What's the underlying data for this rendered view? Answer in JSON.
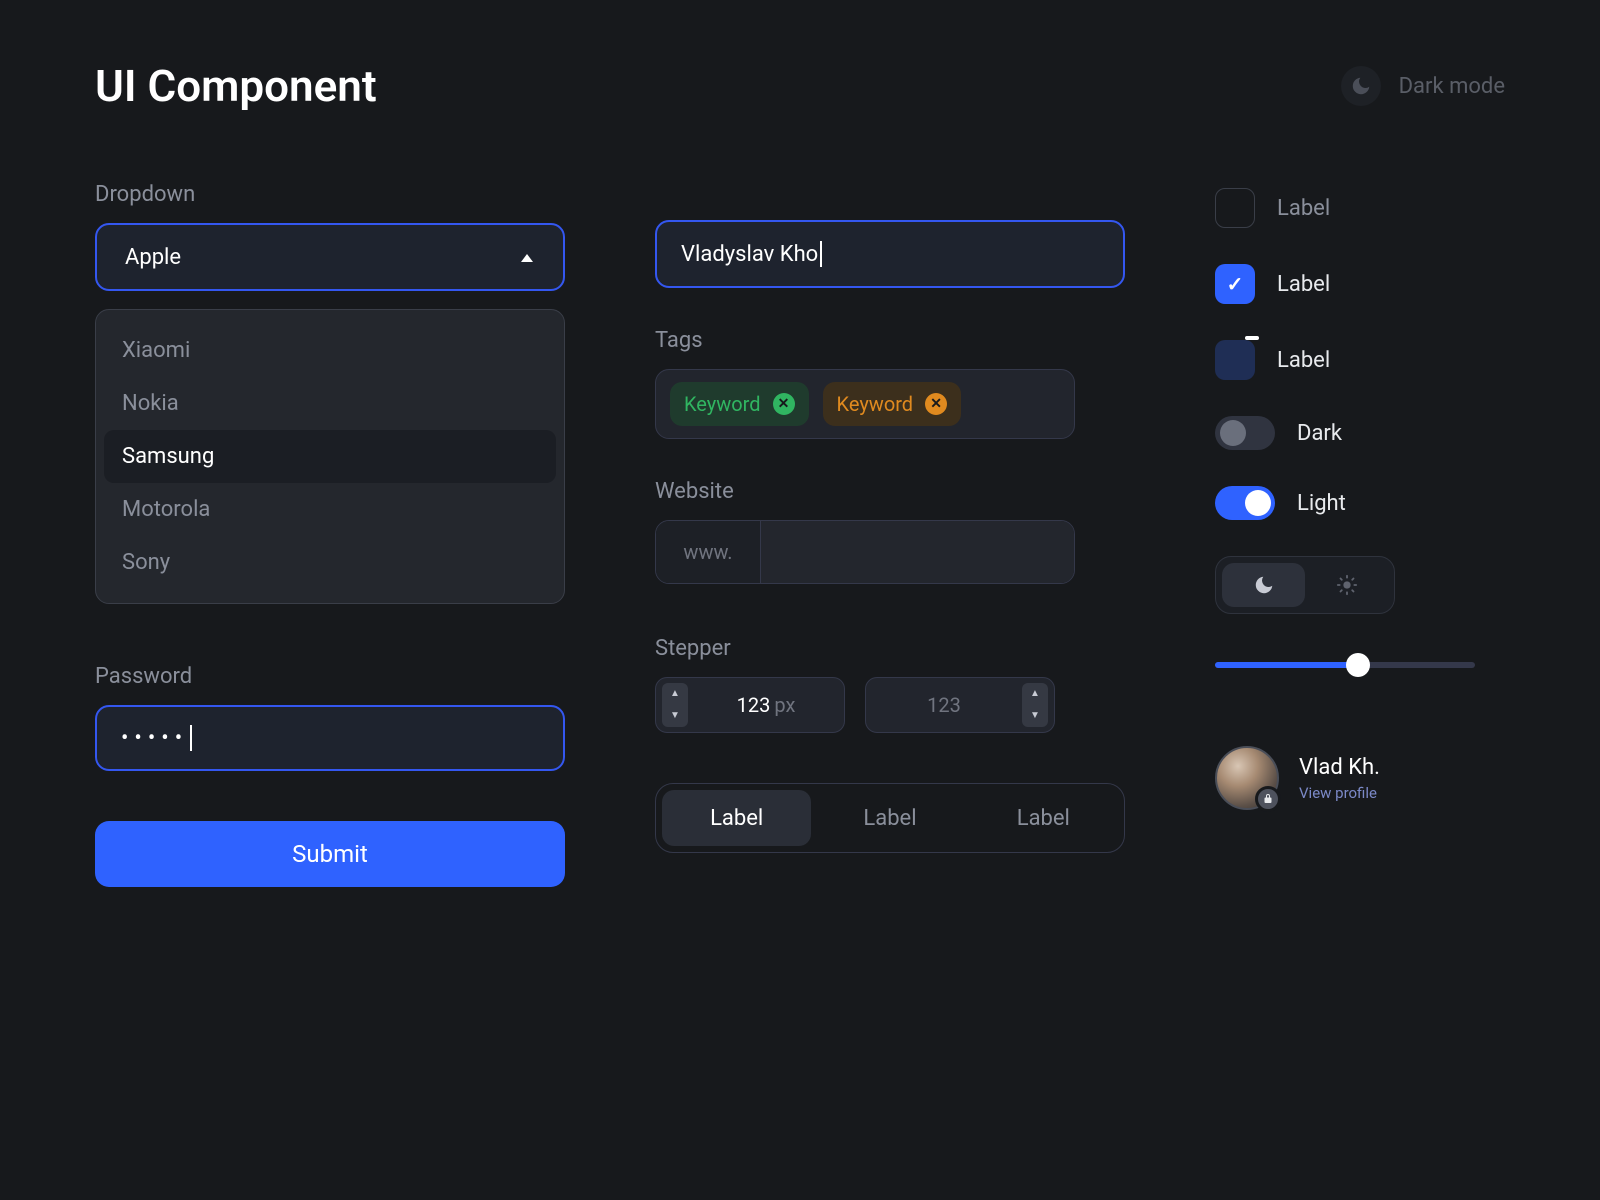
{
  "header": {
    "title": "UI Component",
    "dark_mode_label": "Dark mode"
  },
  "dropdown": {
    "label": "Dropdown",
    "selected": "Apple",
    "options": [
      "Xiaomi",
      "Nokia",
      "Samsung",
      "Motorola",
      "Sony"
    ],
    "highlighted_index": 2
  },
  "password": {
    "label": "Password",
    "masked_value": "•••••"
  },
  "submit": {
    "label": "Submit"
  },
  "name_input": {
    "value": "Vladyslav Kho"
  },
  "tags": {
    "label": "Tags",
    "items": [
      {
        "text": "Keyword",
        "color": "green"
      },
      {
        "text": "Keyword",
        "color": "orange"
      }
    ]
  },
  "website": {
    "label": "Website",
    "prefix": "www."
  },
  "stepper": {
    "label": "Stepper",
    "active_value": "123",
    "unit": "px",
    "placeholder": "123"
  },
  "segmented": {
    "items": [
      "Label",
      "Label",
      "Label"
    ],
    "active_index": 0
  },
  "checkboxes": {
    "unchecked_label": "Label",
    "checked_label": "Label",
    "indeterminate_label": "Label"
  },
  "toggles": {
    "dark_label": "Dark",
    "light_label": "Light"
  },
  "slider": {
    "percent": 55
  },
  "profile": {
    "name": "Vlad Kh.",
    "link": "View profile"
  },
  "colors": {
    "accent": "#2f62ff",
    "bg": "#17191c",
    "surface": "#22252d",
    "text_muted": "#8a8f9b"
  }
}
